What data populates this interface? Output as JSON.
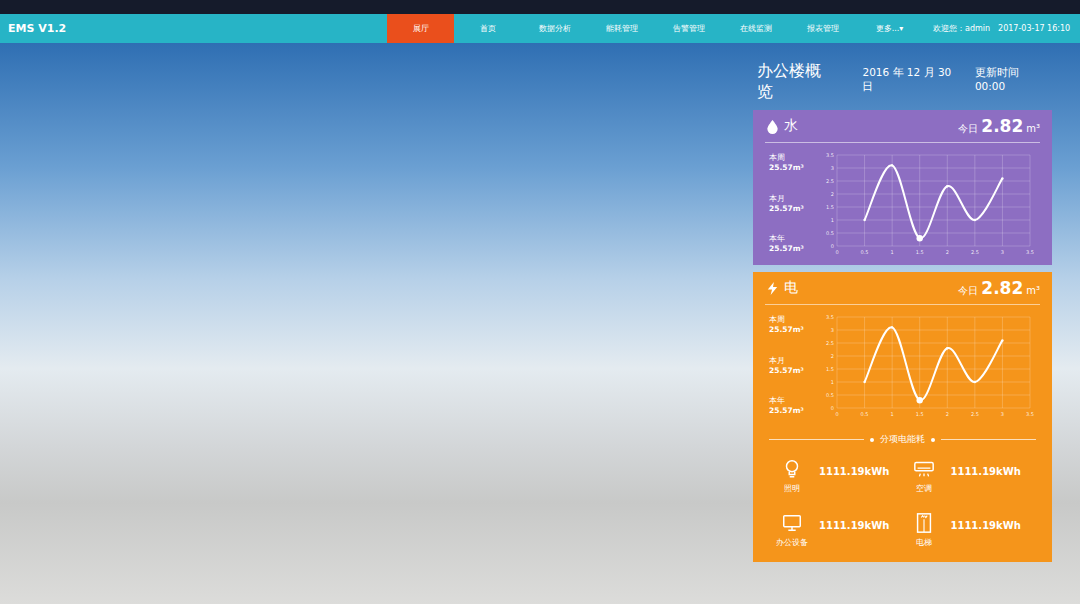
{
  "app": {
    "brand": "EMS V1.2"
  },
  "nav": [
    {
      "label": "展厅",
      "selected": true
    },
    {
      "label": "首页",
      "selected": false
    },
    {
      "label": "数据分析",
      "selected": false
    },
    {
      "label": "能耗管理",
      "selected": false
    },
    {
      "label": "告警管理",
      "selected": false
    },
    {
      "label": "在线监测",
      "selected": false
    },
    {
      "label": "报表管理",
      "selected": false
    },
    {
      "label": "更多...▾",
      "selected": false
    }
  ],
  "user": {
    "welcome": "欢迎您：admin",
    "time": "2017-03-17 16:10"
  },
  "overview": {
    "title": "办公楼概览",
    "date": "2016 年 12 月 30 日",
    "updated": "更新时间 00:00"
  },
  "cards": [
    {
      "kind": "water",
      "title": "水",
      "today_label": "今日",
      "today_value": "2.82",
      "today_unit": "m³",
      "stats": [
        {
          "label": "本周",
          "value": "25.57m³"
        },
        {
          "label": "本月",
          "value": "25.57m³"
        },
        {
          "label": "本年",
          "value": "25.57m³"
        }
      ],
      "chart": {
        "y_ticks": [
          "0",
          "0.5",
          "1",
          "1.5",
          "2",
          "2.5",
          "3",
          "3.5"
        ],
        "x_ticks": [
          "0",
          "0.5",
          "1",
          "1.5",
          "2",
          "2.5",
          "3",
          "3.5"
        ],
        "x": [
          0.5,
          1,
          1.5,
          2,
          2.5,
          3
        ],
        "y": [
          1.0,
          3.1,
          0.3,
          2.3,
          1.0,
          2.6
        ],
        "marked": 2
      }
    },
    {
      "kind": "electric",
      "title": "电",
      "today_label": "今日",
      "today_value": "2.82",
      "today_unit": "m³",
      "stats": [
        {
          "label": "本周",
          "value": "25.57m³"
        },
        {
          "label": "本月",
          "value": "25.57m³"
        },
        {
          "label": "本年",
          "value": "25.57m³"
        }
      ],
      "chart": {
        "y_ticks": [
          "0",
          "0.5",
          "1",
          "1.5",
          "2",
          "2.5",
          "3",
          "3.5"
        ],
        "x_ticks": [
          "0",
          "0.5",
          "1",
          "1.5",
          "2",
          "2.5",
          "3",
          "3.5"
        ],
        "x": [
          0.5,
          1,
          1.5,
          2,
          2.5,
          3
        ],
        "y": [
          1.0,
          3.1,
          0.3,
          2.3,
          1.0,
          2.6
        ],
        "marked": 2
      },
      "breakdown": {
        "title": "分项电能耗",
        "items": [
          {
            "kind": "lighting",
            "label": "照明",
            "value": "1111.19kWh"
          },
          {
            "kind": "ac",
            "label": "空调",
            "value": "1111.19kWh"
          },
          {
            "kind": "office",
            "label": "办公设备",
            "value": "1111.19kWh"
          },
          {
            "kind": "elevator",
            "label": "电梯",
            "value": "1111.19kWh"
          }
        ]
      }
    }
  ]
}
